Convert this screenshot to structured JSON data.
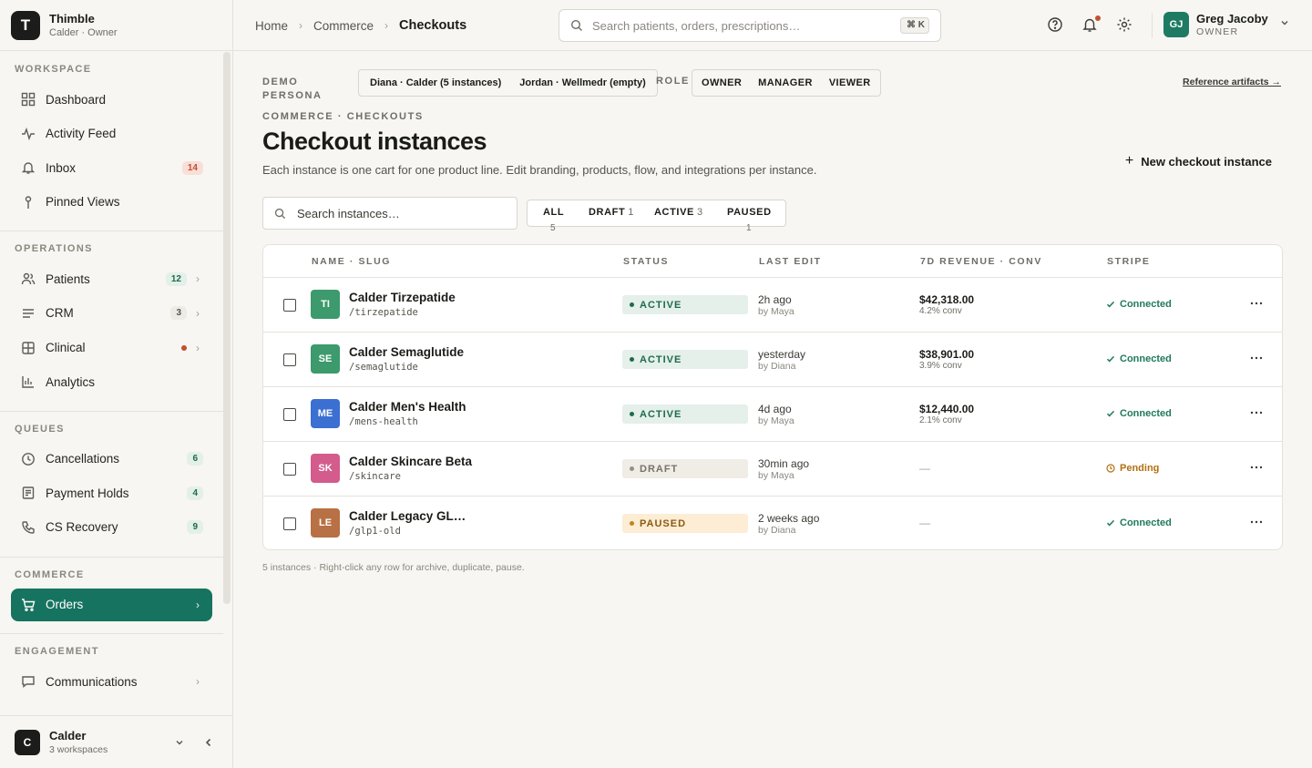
{
  "brand": {
    "logo_letter": "T",
    "name": "Thimble",
    "subtitle": "Calder · Owner"
  },
  "sidebar": {
    "sections": [
      {
        "title": "WORKSPACE",
        "items": [
          {
            "label": "Dashboard",
            "icon": "grid-icon"
          },
          {
            "label": "Activity Feed",
            "icon": "activity-icon"
          },
          {
            "label": "Inbox",
            "icon": "bell-icon",
            "badge": "14"
          },
          {
            "label": "Pinned Views",
            "icon": "pin-icon"
          }
        ]
      },
      {
        "title": "OPERATIONS",
        "items": [
          {
            "label": "Patients",
            "icon": "users-icon",
            "badge": "12"
          },
          {
            "label": "CRM",
            "icon": "list-icon",
            "badge": "3"
          },
          {
            "label": "Clinical",
            "icon": "clinical-icon"
          },
          {
            "label": "Analytics",
            "icon": "bar-chart-icon"
          }
        ]
      },
      {
        "title": "QUEUES",
        "items": [
          {
            "label": "Cancellations",
            "icon": "clock-icon",
            "badge": "6"
          },
          {
            "label": "Payment Holds",
            "icon": "receipt-icon",
            "badge": "4"
          },
          {
            "label": "CS Recovery",
            "icon": "phone-icon",
            "badge": "9"
          }
        ]
      },
      {
        "title": "COMMERCE",
        "items": [
          {
            "label": "Orders",
            "icon": "cart-icon",
            "active": true
          }
        ]
      },
      {
        "title": "ENGAGEMENT",
        "items": [
          {
            "label": "Communications",
            "icon": "message-icon"
          }
        ]
      }
    ],
    "footer": {
      "logo_letter": "C",
      "name": "Calder",
      "subtitle": "3 workspaces"
    }
  },
  "topbar": {
    "breadcrumbs": [
      "Home",
      "Commerce",
      "Checkouts"
    ],
    "search": {
      "placeholder": "Search patients, orders, prescriptions…",
      "shortcut": "⌘ K"
    },
    "user": {
      "initials": "GJ",
      "name": "Greg Jacoby",
      "role": "OWNER"
    }
  },
  "demo": {
    "persona_label": "DEMO PERSONA",
    "personas": [
      "Diana · Calder (5 instances)",
      "Jordan · Wellmedr (empty)"
    ],
    "role_label": "ROLE",
    "roles": [
      "OWNER",
      "MANAGER",
      "VIEWER"
    ],
    "reference_link": "Reference artifacts →"
  },
  "page": {
    "overline": "COMMERCE · CHECKOUTS",
    "title": "Checkout instances",
    "description": "Each instance is one cart for one product line. Edit branding, products, flow, and integrations per instance.",
    "new_button": "New checkout instance",
    "search_placeholder": "Search instances…",
    "filters": [
      {
        "label": "ALL",
        "count": "5"
      },
      {
        "label": "DRAFT",
        "count": "1"
      },
      {
        "label": "ACTIVE",
        "count": "3"
      },
      {
        "label": "PAUSED",
        "count": "1"
      }
    ],
    "footnote": "5 instances · Right-click any row for archive, duplicate, pause."
  },
  "table": {
    "columns": [
      "NAME · SLUG",
      "STATUS",
      "LAST EDIT",
      "7D REVENUE · CONV",
      "STRIPE"
    ],
    "rows": [
      {
        "initials": "TI",
        "color": "#3c9a6c",
        "name": "Calder Tirzepatide",
        "slug": "/tirzepatide",
        "status": "ACTIVE",
        "edit_time": "2h ago",
        "edit_by": "by Maya",
        "revenue": "$42,318.00",
        "conv": "4.2% conv",
        "stripe": "Connected"
      },
      {
        "initials": "SE",
        "color": "#3c9a6c",
        "name": "Calder Semaglutide",
        "slug": "/semaglutide",
        "status": "ACTIVE",
        "edit_time": "yesterday",
        "edit_by": "by Diana",
        "revenue": "$38,901.00",
        "conv": "3.9% conv",
        "stripe": "Connected"
      },
      {
        "initials": "ME",
        "color": "#3b6fd1",
        "name": "Calder Men's Health",
        "slug": "/mens-health",
        "status": "ACTIVE",
        "edit_time": "4d ago",
        "edit_by": "by Maya",
        "revenue": "$12,440.00",
        "conv": "2.1% conv",
        "stripe": "Connected"
      },
      {
        "initials": "SK",
        "color": "#d35c8d",
        "name": "Calder Skincare Beta",
        "slug": "/skincare",
        "status": "DRAFT",
        "edit_time": "30min ago",
        "edit_by": "by Maya",
        "revenue": "—",
        "conv": "",
        "stripe": "Pending"
      },
      {
        "initials": "LE",
        "color": "#b77144",
        "name": "Calder Legacy GL…",
        "slug": "/glp1-old",
        "status": "PAUSED",
        "edit_time": "2 weeks ago",
        "edit_by": "by Diana",
        "revenue": "—",
        "conv": "",
        "stripe": "Connected"
      }
    ]
  },
  "colors": {
    "accent": "#16735f",
    "active_status": "#1f6a4d",
    "pending": "#b2700f",
    "alert": "#c2502f"
  }
}
